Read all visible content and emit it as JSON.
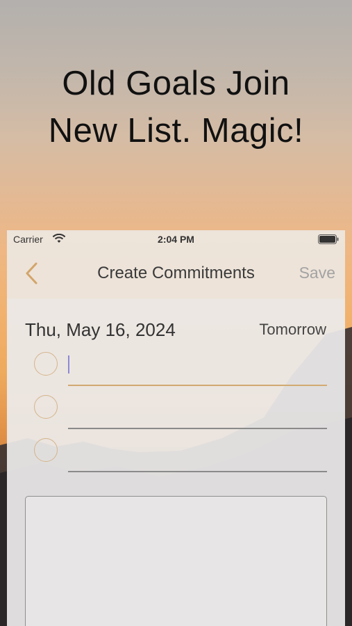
{
  "headline": {
    "line1": "Old Goals Join",
    "line2": "New List. Magic!"
  },
  "status_bar": {
    "carrier": "Carrier",
    "time": "2:04 PM",
    "wifi_icon": "wifi-icon",
    "battery_icon": "battery-icon"
  },
  "nav": {
    "back_icon": "chevron-left-icon",
    "title": "Create Commitments",
    "save_label": "Save"
  },
  "form": {
    "date": "Thu, May 16, 2024",
    "day_label": "Tomorrow",
    "goals": [
      {
        "value": "",
        "active": true
      },
      {
        "value": "",
        "active": false
      },
      {
        "value": "",
        "active": false
      }
    ],
    "notes_value": ""
  },
  "colors": {
    "accent": "#d1aa72",
    "save_disabled": "#a3a3a3",
    "cursor": "#8c88d6"
  }
}
